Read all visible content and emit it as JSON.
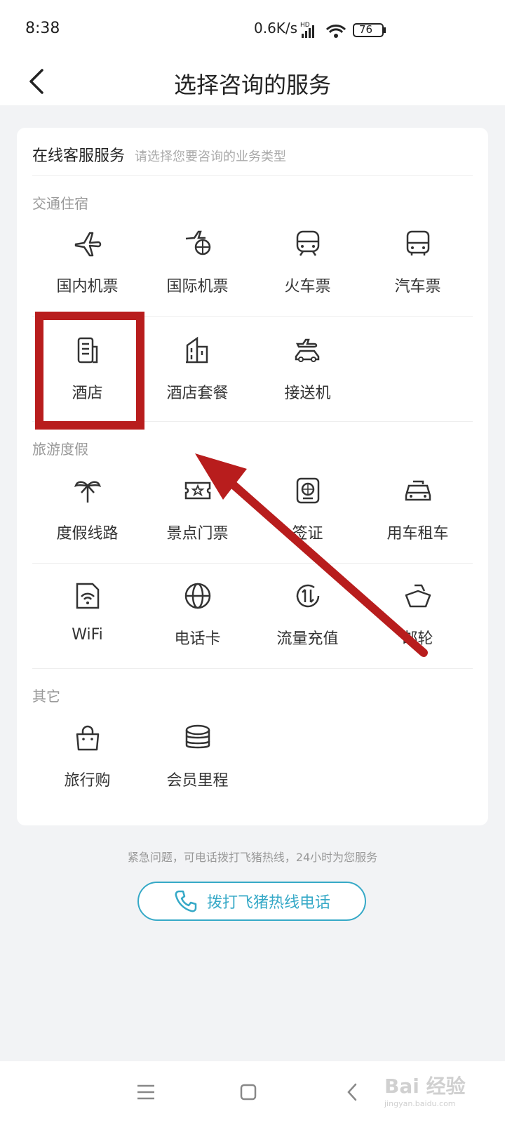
{
  "status": {
    "time": "8:38",
    "speed": "0.6K/s",
    "battery": "76"
  },
  "header": {
    "title": "选择咨询的服务"
  },
  "card": {
    "title": "在线客服服务",
    "subtitle": "请选择您要咨询的业务类型"
  },
  "sections": [
    {
      "title": "交通住宿"
    },
    {
      "title": "旅游度假"
    },
    {
      "title": "其它"
    }
  ],
  "items": {
    "domestic_flight": "国内机票",
    "intl_flight": "国际机票",
    "train": "火车票",
    "bus": "汽车票",
    "hotel": "酒店",
    "hotel_package": "酒店套餐",
    "transfer": "接送机",
    "vacation": "度假线路",
    "attraction": "景点门票",
    "visa": "签证",
    "car_rental": "用车租车",
    "wifi": "WiFi",
    "phone_card": "电话卡",
    "data_topup": "流量充值",
    "cruise": "邮轮",
    "shopping": "旅行购",
    "mileage": "会员里程"
  },
  "footer": {
    "note": "紧急问题，可电话拨打飞猪热线，24小时为您服务",
    "hotline_label": "拨打飞猪热线电话"
  },
  "colors": {
    "accent": "#36a9c7",
    "highlight": "#b81d1d",
    "background": "#f2f3f5"
  },
  "watermark": {
    "text": "Bai 经验",
    "sub": "jingyan.baidu.com"
  }
}
